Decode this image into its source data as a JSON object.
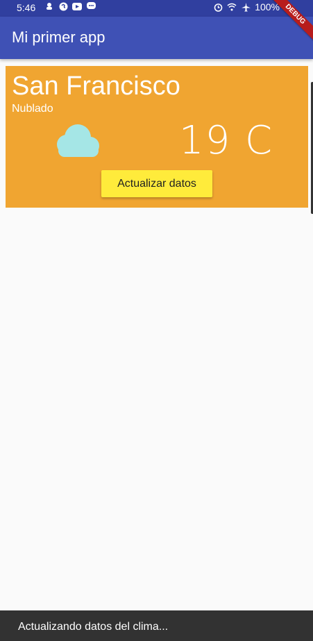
{
  "status_bar": {
    "time": "5:46",
    "battery": "100%",
    "left_icons": [
      "notification-icon",
      "shazam-icon",
      "youtube-icon",
      "chat-icon"
    ],
    "right_icons": [
      "alarm-icon",
      "wifi-icon",
      "airplane-icon",
      "battery-icon"
    ]
  },
  "app_bar": {
    "title": "Mi primer app",
    "debug_label": "DEBUG"
  },
  "weather": {
    "city": "San Francisco",
    "description": "Nublado",
    "temperature": "19 C",
    "icon": "cloud-icon",
    "button_label": "Actualizar datos"
  },
  "snackbar": {
    "message": "Actualizando datos del clima..."
  },
  "colors": {
    "status_bar": "#303f9f",
    "app_bar": "#3f51b5",
    "card": "#f0a531",
    "button": "#ffeb3b",
    "cloud": "#a5e6e6",
    "snackbar": "#323232"
  }
}
